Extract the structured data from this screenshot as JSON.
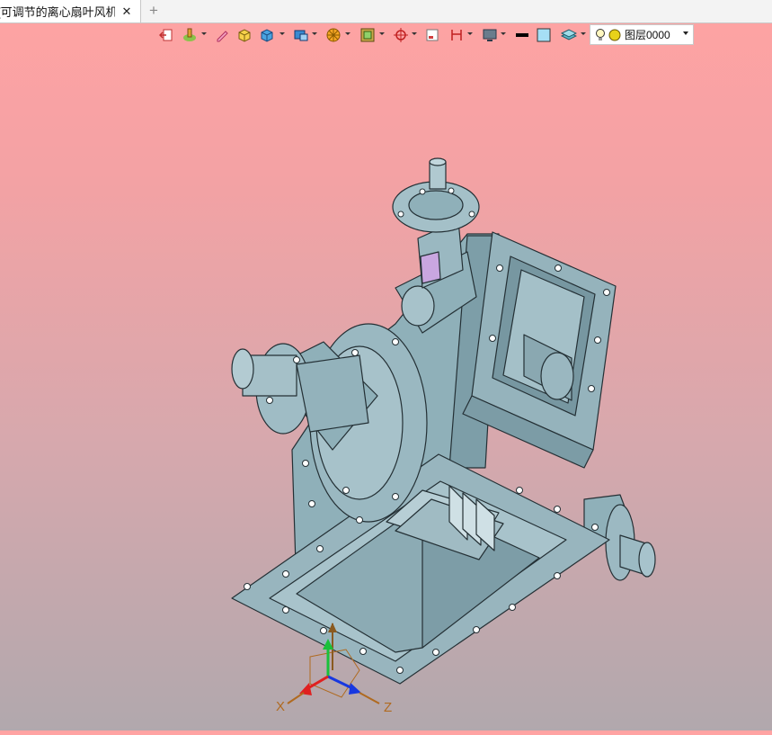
{
  "tab": {
    "title": "[可调节的离心扇叶风机]",
    "close_glyph": "✕",
    "add_glyph": "+"
  },
  "toolbar": {
    "layer_name": "图层0000",
    "icons": [
      "exit-icon",
      "paint-icon",
      "pen-icon",
      "shaded-box-icon",
      "box-icon",
      "view-cube-icon",
      "render-wheel-icon",
      "texture-icon",
      "crosshair-icon",
      "frame-icon",
      "dimension-icon",
      "monitor-icon",
      "line-color-swatch",
      "fill-color-swatch",
      "layer-stack-icon",
      "bulb-icon",
      "sun-icon"
    ]
  },
  "axis": {
    "x": "X",
    "z": "Z"
  },
  "colors": {
    "model": "#90aeb7",
    "model_dark": "#6e8d97",
    "outline": "#243035",
    "accent_green": "#19c13a",
    "accent_blue": "#1838e0",
    "accent_red": "#e02020",
    "triad_orange": "#b06a20"
  }
}
